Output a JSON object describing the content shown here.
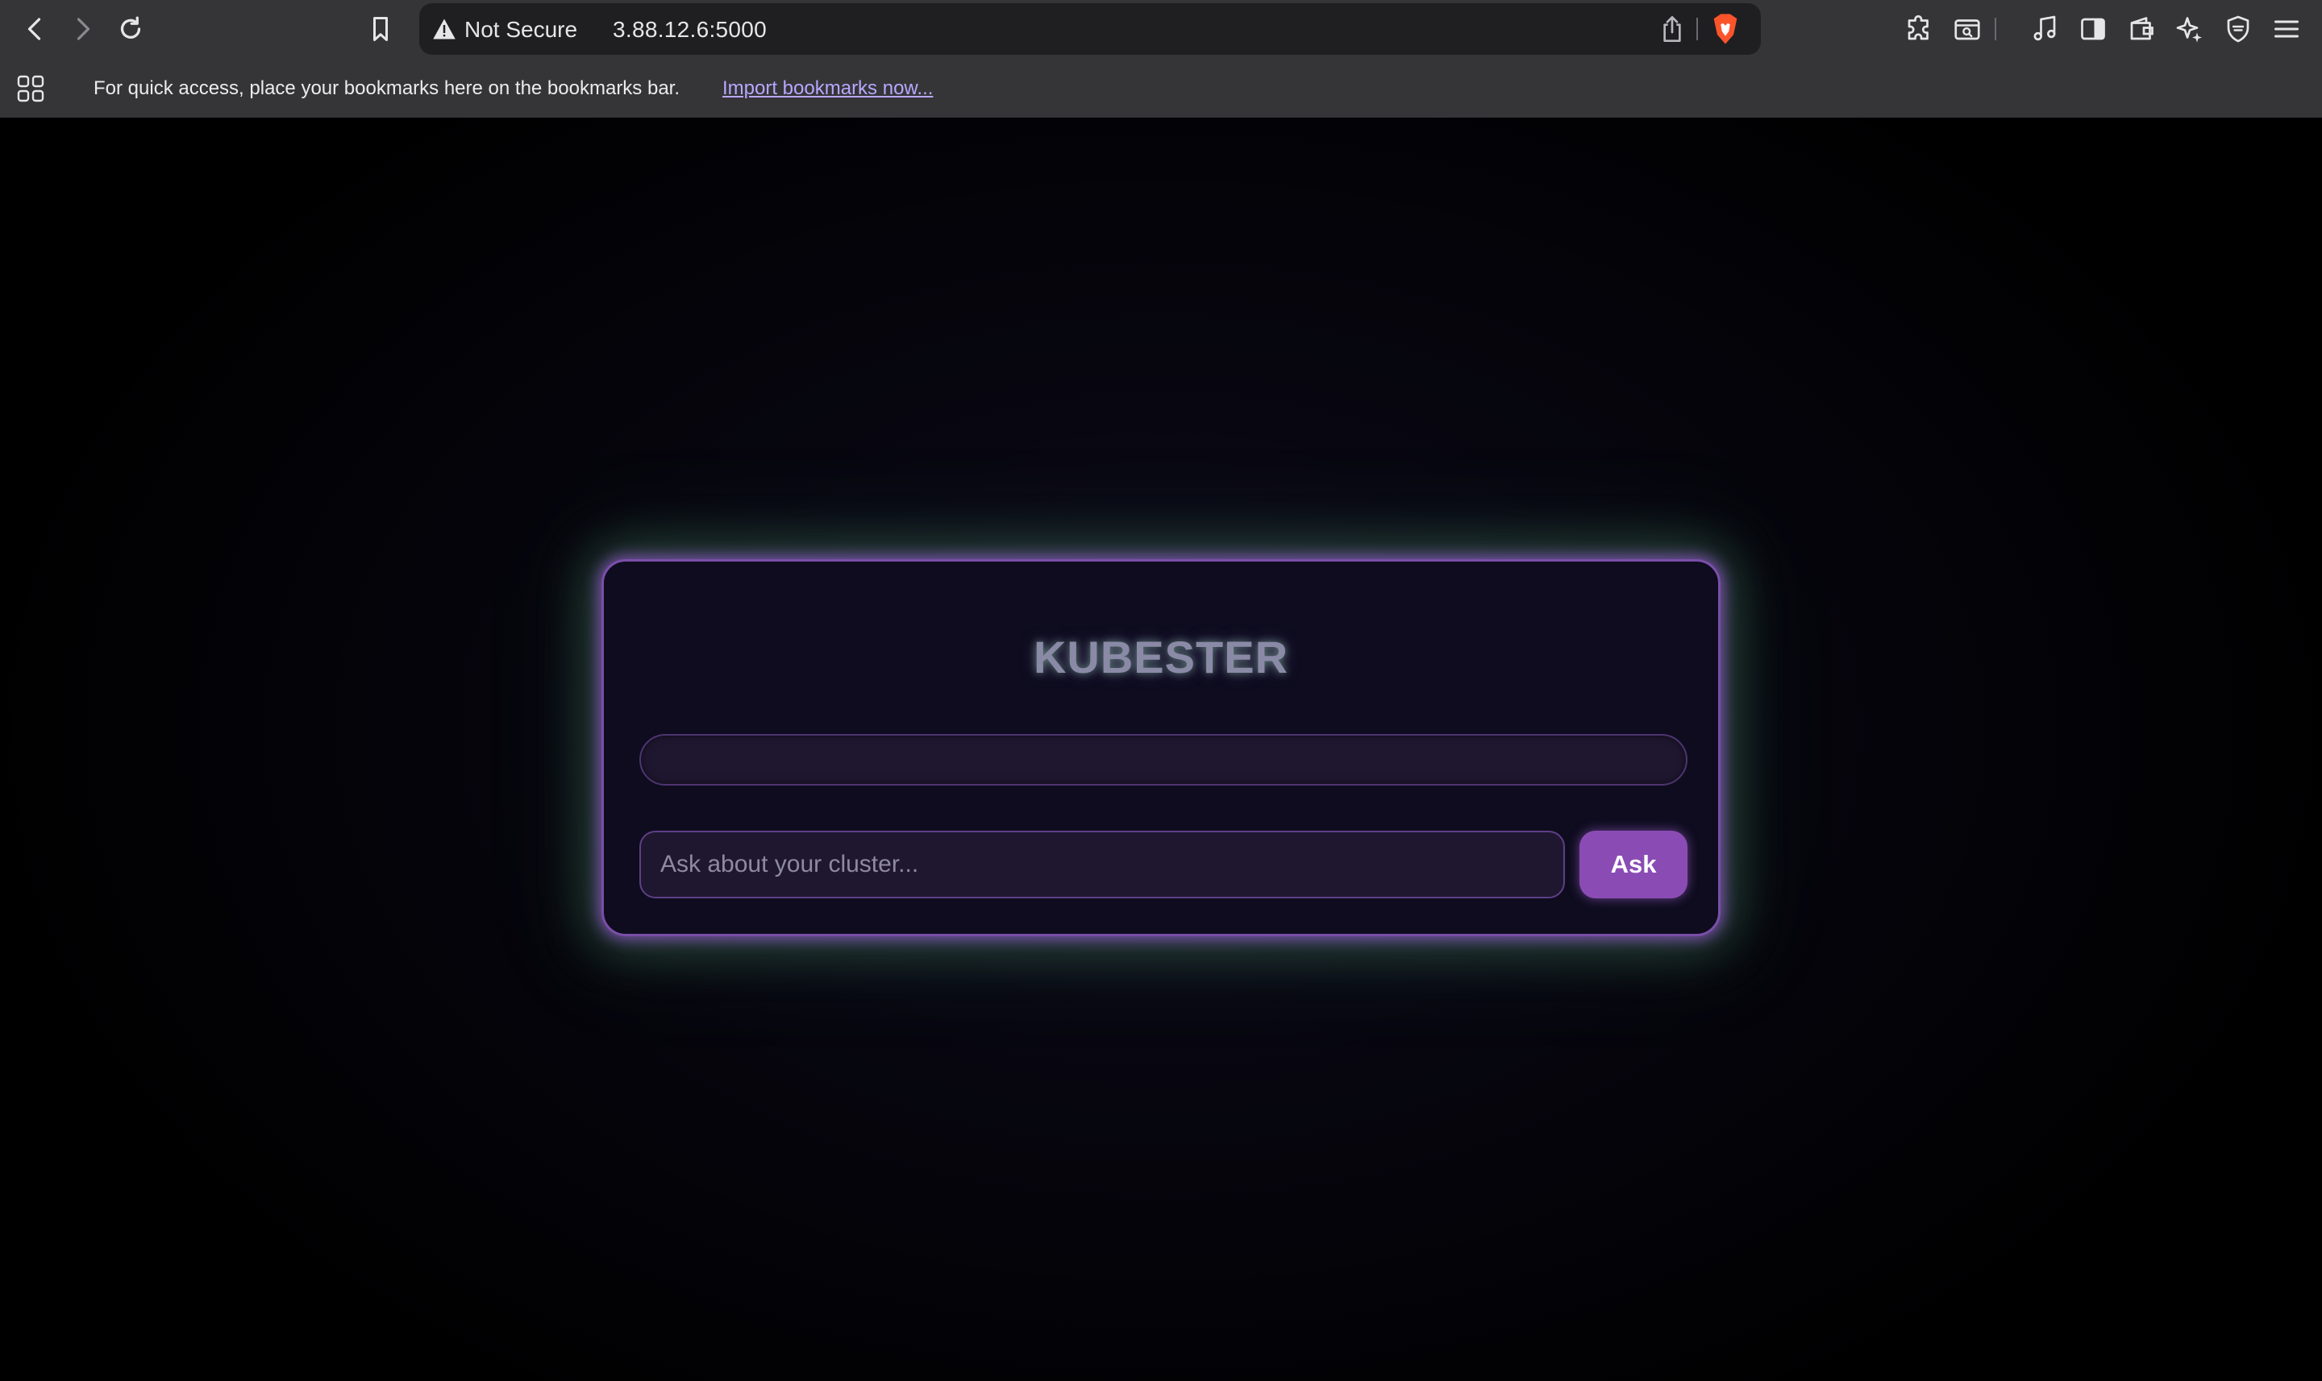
{
  "browser": {
    "security_label": "Not Secure",
    "url": "3.88.12.6:5000",
    "icons": [
      "back-icon",
      "forward-icon",
      "reload-icon",
      "bookmark-icon",
      "warning-icon",
      "share-icon",
      "brave-shields-icon",
      "extensions-icon",
      "reader-icon",
      "media-icon",
      "sidebar-icon",
      "wallet-icon",
      "leo-ai-icon",
      "vpn-icon",
      "menu-icon"
    ]
  },
  "bookmarks_bar": {
    "hint": "For quick access, place your bookmarks here on the bookmarks bar.",
    "import_link": "Import bookmarks now..."
  },
  "app": {
    "title": "KUBESTER",
    "response": "",
    "input_placeholder": "Ask about your cluster...",
    "input_value": "",
    "ask_label": "Ask"
  },
  "colors": {
    "accent": "#8a4cb4",
    "card_border": "#7a4ea8",
    "glow_green": "#78c896"
  }
}
